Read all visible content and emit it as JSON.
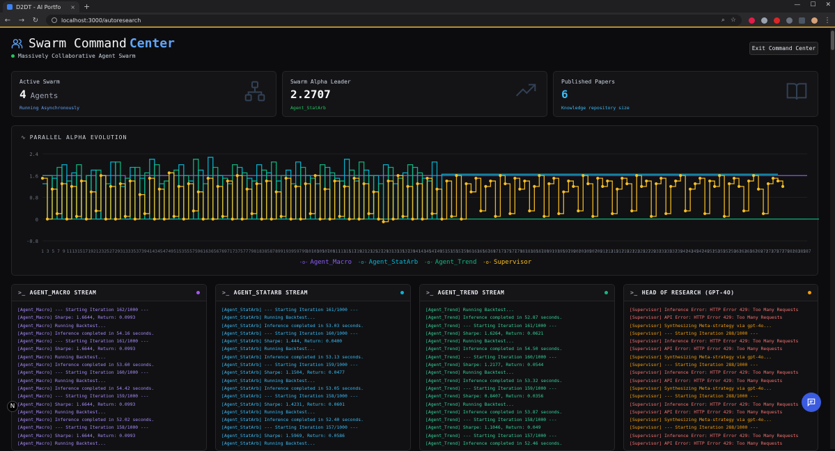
{
  "browser": {
    "tab_title": "D2DT - AI Portfo",
    "tab_close": "×",
    "new_tab": "+",
    "url": "localhost:3000/autoresearch"
  },
  "header": {
    "title_main": "Swarm Command",
    "title_highlight": "Center",
    "subtitle": "Massively Collaborative Agent Swarm",
    "exit_label": "Exit Command Center"
  },
  "stats": [
    {
      "label": "Active Swarm",
      "value": "4",
      "unit": "Agents",
      "foot": "Running Asynchronously",
      "foot_color": "#60a5fa",
      "icon": "network-icon"
    },
    {
      "label": "Swarm Alpha Leader",
      "value": "2.2707",
      "unit": "",
      "foot": "Agent_StatArb",
      "foot_color": "#22c55e",
      "icon": "trending-up-icon"
    },
    {
      "label": "Published Papers",
      "value": "6",
      "unit": "",
      "foot": "Knowledge repository size",
      "foot_color": "#38bdf8",
      "icon": "book-open-icon"
    }
  ],
  "chart_title": "PARALLEL ALPHA EVOLUTION",
  "chart_data": {
    "type": "line",
    "yticks": [
      "2.4",
      "1.6",
      "0.8",
      "0",
      "-0.8"
    ],
    "ylim": [
      -0.8,
      2.4
    ],
    "xlabels_start": 1,
    "xlabels_step": 2,
    "xlabels_end": 287,
    "series": [
      {
        "name": "Agent_Macro",
        "color": "#8b5cf6",
        "values": [
          1.6,
          1.6,
          1.6,
          1.6,
          0,
          1.6,
          1.6,
          1.6,
          0,
          1.6,
          1.6,
          0,
          1.6,
          1.6,
          1.6,
          1.6,
          1.6,
          0,
          1.6,
          1.6,
          1.6,
          1.6,
          1.6,
          1.6,
          1.6,
          1.6,
          0,
          1.6,
          1.6,
          1.6,
          1.6,
          1.6,
          1.6,
          1.6,
          1.6,
          1.6,
          1.6,
          1.6,
          1.6,
          1.6,
          0,
          1.6,
          1.6,
          1.6,
          1.6,
          1.6,
          1.6,
          1.6,
          1.6,
          1.6,
          1.6,
          1.6,
          1.6,
          1.6,
          1.6,
          1.6,
          1.6,
          1.6,
          1.6,
          1.6,
          1.6,
          1.6,
          1.6,
          1.6,
          1.6,
          1.6,
          1.6,
          1.6,
          1.6,
          1.6,
          1.6,
          1.6,
          1.6,
          1.6,
          1.6,
          1.6,
          1.6,
          1.6,
          1.6,
          1.6,
          1.6,
          1.6,
          1.6,
          1.6,
          1.6,
          1.6,
          1.6,
          1.6,
          1.6,
          1.6,
          1.6,
          1.6,
          1.6,
          1.6,
          1.6,
          1.6,
          1.6,
          1.6,
          1.6,
          1.6,
          1.6,
          1.6,
          1.6,
          1.6,
          1.6,
          1.6,
          1.6,
          1.6,
          1.6,
          1.6,
          1.6,
          1.6,
          1.6,
          1.6,
          1.6,
          1.6,
          1.6,
          1.6,
          1.6,
          1.6,
          1.6,
          1.6,
          1.6,
          1.6,
          1.6,
          1.6,
          1.6,
          1.6,
          1.6,
          1.6,
          1.6,
          1.6,
          1.6,
          1.6,
          1.6,
          1.6,
          1.6,
          1.6,
          1.6,
          1.6,
          1.6,
          1.6,
          1.6,
          1.6,
          1.6,
          1.6,
          1.6,
          1.6,
          1.6,
          1.6,
          1.6,
          1.6,
          1.6,
          1.6,
          1.6,
          1.6,
          1.6,
          1.6
        ]
      },
      {
        "name": "Agent_StatArb",
        "color": "#06b6d4",
        "values": [
          1.3,
          0,
          1.5,
          0,
          2.0,
          0,
          1.7,
          0,
          1.4,
          0,
          1.8,
          0,
          1.6,
          0,
          2.1,
          0,
          1.2,
          0,
          1.9,
          0,
          1.5,
          0,
          2.2,
          0,
          1.3,
          0,
          1.7,
          0,
          2.0,
          0,
          1.4,
          0,
          1.8,
          0,
          2.27,
          0,
          1.6,
          0,
          1.3,
          0,
          1.9,
          0,
          1.5,
          0,
          2.0,
          0,
          1.7,
          0,
          1.4,
          0,
          1.8,
          0,
          2.1,
          0,
          1.6,
          0,
          1.3,
          0,
          1.9,
          0,
          1.5,
          0,
          2.2,
          0,
          1.4,
          0,
          1.8,
          0,
          1.6,
          0,
          2.0,
          0,
          1.3,
          0,
          1.7,
          0,
          1.9,
          0,
          1.5,
          0,
          2.1,
          0,
          1.65,
          1.65,
          1.65,
          1.65,
          1.65,
          1.65,
          1.65,
          1.65,
          1.65,
          1.65,
          1.65,
          1.65,
          1.65,
          1.65,
          1.65,
          1.65,
          1.65,
          1.65,
          1.65,
          1.65,
          1.65,
          1.65,
          1.65,
          1.65,
          1.65,
          1.65,
          1.65,
          1.65,
          1.65,
          1.65,
          1.65,
          1.65,
          1.65,
          1.65,
          1.65,
          1.65,
          1.65,
          1.65,
          1.65,
          1.65,
          1.65,
          1.65,
          1.65,
          1.65,
          1.65,
          1.65,
          1.65,
          1.65,
          1.65,
          1.65,
          1.65,
          1.65,
          1.65,
          1.65,
          1.65,
          1.65,
          1.65,
          1.65,
          1.65,
          1.65,
          1.65,
          1.65,
          1.65,
          1.65,
          1.65,
          1.65,
          1.65,
          1.65,
          1.65,
          1.65
        ]
      },
      {
        "name": "Agent_Trend",
        "color": "#10b981",
        "values": [
          1.6,
          1.6,
          0,
          1.9,
          0,
          1.4,
          0,
          2.0,
          0,
          1.6,
          0,
          1.8,
          0,
          1.3,
          0,
          2.1,
          0,
          1.5,
          0,
          1.9,
          0,
          1.7,
          0,
          2.0,
          0,
          1.4,
          0,
          1.8,
          0,
          1.6,
          0,
          2.2,
          0,
          1.3,
          0,
          1.9,
          0,
          1.5,
          0,
          2.0,
          0,
          1.7,
          0,
          1.4,
          0,
          1.8,
          0,
          2.1,
          0,
          1.6,
          0,
          1.3,
          0,
          1.9,
          0,
          1.5,
          0,
          2.0,
          0,
          1.7,
          0,
          1.4,
          0,
          1.8,
          0,
          2.1,
          0,
          1.6,
          0,
          1.3,
          0,
          1.9,
          0,
          1.5,
          0,
          2.0,
          0,
          1.7,
          0,
          1.4,
          0,
          0,
          0,
          0,
          0,
          0,
          0,
          0,
          0,
          0,
          0,
          0,
          0,
          0,
          0,
          0,
          0,
          0,
          0,
          0,
          0,
          0,
          0,
          0,
          0,
          0,
          0,
          0,
          0,
          0,
          0,
          0,
          0,
          0,
          0,
          0,
          0,
          0,
          0,
          0,
          0,
          0,
          0,
          0,
          0,
          0,
          0,
          0,
          0,
          0,
          0,
          0,
          0,
          0,
          0,
          0,
          0,
          0,
          0,
          0,
          0,
          0,
          0,
          0,
          0,
          0,
          0,
          0,
          0,
          0,
          0,
          0,
          0,
          0,
          0,
          0,
          0,
          0,
          0,
          0,
          0,
          0
        ]
      },
      {
        "name": "Supervisor",
        "color": "#fbbf24",
        "values": [
          1.5,
          0,
          1.1,
          0.2,
          1.3,
          0,
          1.2,
          0.1,
          1.4,
          0,
          1.0,
          0.3,
          1.6,
          0,
          1.2,
          0,
          1.3,
          0.1,
          1.4,
          0,
          0.9,
          0.2,
          1.5,
          0,
          1.1,
          0,
          1.7,
          0.1,
          1.2,
          0,
          1.3,
          0.3,
          1.0,
          0,
          1.5,
          0,
          1.2,
          0.1,
          1.4,
          0,
          1.6,
          0,
          1.1,
          0.2,
          1.3,
          0,
          1.4,
          0,
          1.0,
          0.1,
          1.5,
          0,
          1.2,
          0,
          1.3,
          0.2,
          1.6,
          0,
          1.1,
          0,
          1.4,
          0.1,
          1.2,
          0,
          1.5,
          0,
          1.3,
          0.2,
          1.0,
          0,
          -0.1,
          1.4,
          0,
          1.6,
          0.1,
          1.2,
          0,
          1.3,
          0,
          1.5,
          0.2,
          1.1,
          0,
          1.4,
          0.1,
          1.6,
          0,
          1.3,
          1.0,
          1.5,
          0.3,
          1.2,
          1.4,
          0.1,
          1.6,
          1.3,
          0.2,
          1.5,
          1.1,
          1.4,
          0.3,
          1.2,
          1.6,
          0.1,
          1.3,
          1.5,
          0.2,
          1.0,
          1.4,
          1.2,
          0.3,
          1.6,
          1.3,
          0.1,
          1.5,
          1.2,
          1.4,
          0.2,
          1.1,
          1.5,
          1.3,
          0.3,
          1.6,
          1.2,
          1.4,
          0.1,
          1.3,
          1.5,
          0.2,
          1.2,
          1.4,
          1.6,
          0.3,
          1.1,
          1.3,
          1.5,
          0.2,
          1.4,
          1.2,
          1.6,
          0.1,
          1.3,
          1.5,
          1.2,
          0.3,
          1.4,
          1.6,
          1.1,
          0.2,
          1.3,
          1.5,
          1.4,
          1.2
        ]
      }
    ]
  },
  "panels": [
    {
      "title": "AGENT_MACRO STREAM",
      "dot": "#a855f7",
      "color": "#a78bfa",
      "lines": [
        "[Agent_Macro] --- Starting Iteration 162/1000 ---",
        "[Agent_Macro] Sharpe: 1.6644, Return: 0.0993",
        "[Agent_Macro] Running Backtest...",
        "[Agent_Macro] Inference completed in 54.16 seconds.",
        "[Agent_Macro] --- Starting Iteration 161/1000 ---",
        "[Agent_Macro] Sharpe: 1.6644, Return: 0.0993",
        "[Agent_Macro] Running Backtest...",
        "[Agent_Macro] Inference completed in 53.60 seconds.",
        "[Agent_Macro] --- Starting Iteration 160/1000 ---",
        "[Agent_Macro] Running Backtest...",
        "[Agent_Macro] Inference completed in 54.42 seconds.",
        "[Agent_Macro] --- Starting Iteration 159/1000 ---",
        "[Agent_Macro] Sharpe: 1.6644, Return: 0.0993",
        "[Agent_Macro] Running Backtest...",
        "[Agent_Macro] Inference completed in 52.02 seconds.",
        "[Agent_Macro] --- Starting Iteration 158/1000 ---",
        "[Agent_Macro] Sharpe: 1.6644, Return: 0.0993",
        "[Agent_Macro] Running Backtest..."
      ]
    },
    {
      "title": "AGENT_STATARB STREAM",
      "dot": "#06b6d4",
      "color": "#38bdf8",
      "lines": [
        "[Agent_StatArb] --- Starting Iteration 161/1000 ---",
        "[Agent_StatArb] Running Backtest...",
        "[Agent_StatArb] Inference completed in 53.03 seconds.",
        "[Agent_StatArb] --- Starting Iteration 160/1000 ---",
        "[Agent_StatArb] Sharpe: 1.444, Return: 0.0400",
        "[Agent_StatArb] Running Backtest...",
        "[Agent_StatArb] Inference completed in 53.13 seconds.",
        "[Agent_StatArb] --- Starting Iteration 159/1000 ---",
        "[Agent_StatArb] Sharpe: 1.1504, Return: 0.0477",
        "[Agent_StatArb] Running Backtest...",
        "[Agent_StatArb] Inference completed in 53.05 seconds.",
        "[Agent_StatArb] --- Starting Iteration 158/1000 ---",
        "[Agent_StatArb] Sharpe: 1.4231, Return: 0.0601",
        "[Agent_StatArb] Running Backtest...",
        "[Agent_StatArb] Inference completed in 52.40 seconds.",
        "[Agent_StatArb] --- Starting Iteration 157/1000 ---",
        "[Agent_StatArb] Sharpe: 1.5969, Return: 0.0586",
        "[Agent_StatArb] Running Backtest..."
      ]
    },
    {
      "title": "AGENT_TREND STREAM",
      "dot": "#10b981",
      "color": "#34d399",
      "lines": [
        "[Agent_Trend] Running Backtest...",
        "[Agent_Trend] Inference completed in 52.87 seconds.",
        "[Agent_Trend] --- Starting Iteration 161/1000 ---",
        "[Agent_Trend] Sharpe: 1.6264, Return: 0.0621",
        "[Agent_Trend] Running Backtest...",
        "[Agent_Trend] Inference completed in 54.50 seconds.",
        "[Agent_Trend] --- Starting Iteration 160/1000 ---",
        "[Agent_Trend] Sharpe: 1.2177, Return: 0.0544",
        "[Agent_Trend] Running Backtest...",
        "[Agent_Trend] Inference completed in 53.32 seconds.",
        "[Agent_Trend] --- Starting Iteration 159/1000 ---",
        "[Agent_Trend] Sharpe: 0.8407, Return: 0.0356",
        "[Agent_Trend] Running Backtest...",
        "[Agent_Trend] Inference completed in 53.87 seconds.",
        "[Agent_Trend] --- Starting Iteration 158/1000 ---",
        "[Agent_Trend] Sharpe: 1.1046, Return: 0.049",
        "[Agent_Trend] --- Starting Iteration 157/1000 ---",
        "[Agent_Trend] Inference completed in 52.46 seconds."
      ]
    },
    {
      "title": "HEAD OF RESEARCH (GPT-4O)",
      "dot": "#f59e0b",
      "color": "#f59e0b",
      "lines": [
        "[Supervisor] Inference Error: HTTP Error 429: Too Many Requests",
        "[Supervisor] API Error: HTTP Error 429: Too Many Requests",
        "[Supervisor] Synthesizing Meta-strategy via gpt-4o...",
        "[Supervisor] --- Starting Iteration 288/1000 ---",
        "[Supervisor] Inference Error: HTTP Error 429: Too Many Requests",
        "[Supervisor] API Error: HTTP Error 429: Too Many Requests",
        "[Supervisor] Synthesizing Meta-strategy via gpt-4o...",
        "[Supervisor] --- Starting Iteration 288/1000 ---",
        "[Supervisor] Inference Error: HTTP Error 429: Too Many Requests",
        "[Supervisor] API Error: HTTP Error 429: Too Many Requests",
        "[Supervisor] Synthesizing Meta-strategy via gpt-4o...",
        "[Supervisor] --- Starting Iteration 288/1000 ---",
        "[Supervisor] Inference Error: HTTP Error 429: Too Many Requests",
        "[Supervisor] API Error: HTTP Error 429: Too Many Requests",
        "[Supervisor] Synthesizing Meta-strategy via gpt-4o...",
        "[Supervisor] --- Starting Iteration 288/1000 ---",
        "[Supervisor] Inference Error: HTTP Error 429: Too Many Requests",
        "[Supervisor] API Error: HTTP Error 429: Too Many Requests"
      ]
    }
  ],
  "error_line_color": "#f87171",
  "nextjs_badge": "N"
}
